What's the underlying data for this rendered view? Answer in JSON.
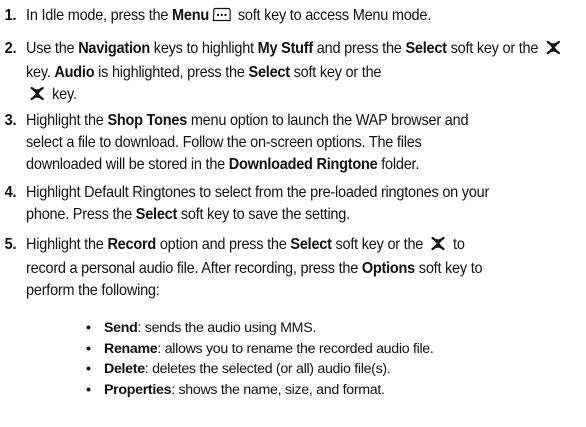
{
  "steps": [
    {
      "num": "1.",
      "parts": [
        {
          "t": "In Idle mode, press the "
        },
        {
          "b": "Menu"
        },
        {
          "icon": "menu-softkey-icon"
        },
        {
          "t": " soft key to access Menu mode."
        }
      ]
    },
    {
      "num": "2.",
      "parts": [
        {
          "t": "Use the "
        },
        {
          "b": "Navigation"
        },
        {
          "t": " keys to highlight "
        },
        {
          "b": "My Stuff"
        },
        {
          "t": " and press the "
        },
        {
          "b": "Select"
        },
        {
          "t": " soft key or the "
        },
        {
          "icon": "select-key-icon"
        },
        {
          "t": " key. "
        },
        {
          "b": "Audio"
        },
        {
          "t": " is highlighted, press the "
        },
        {
          "b": "Select"
        },
        {
          "t": " soft key or the "
        },
        {
          "br": true
        },
        {
          "icon": "select-key-icon"
        },
        {
          "t": " key."
        }
      ]
    },
    {
      "num": "3.",
      "parts": [
        {
          "t": "Highlight the "
        },
        {
          "b": "Shop Tones"
        },
        {
          "t": " menu option to launch the WAP browser and"
        },
        {
          "br": true
        },
        {
          "t": "select a file to download. Follow the on-screen options. The files"
        },
        {
          "br": true
        },
        {
          "t": "downloaded will be stored in the "
        },
        {
          "b": "Downloaded Ringtone"
        },
        {
          "t": " folder."
        }
      ]
    },
    {
      "num": "4.",
      "parts": [
        {
          "t": "Highlight Default Ringtones to select from the pre-loaded ringtones on your"
        },
        {
          "br": true
        },
        {
          "t": "phone. Press the "
        },
        {
          "b": "Select"
        },
        {
          "t": " soft key to save the setting."
        }
      ]
    },
    {
      "num": "5.",
      "parts": [
        {
          "t": "Highlight the "
        },
        {
          "b": "Record"
        },
        {
          "t": " option and press the "
        },
        {
          "b": "Select"
        },
        {
          "t": " soft key or the "
        },
        {
          "icon": "select-key-icon"
        },
        {
          "t": " to"
        },
        {
          "br": true
        },
        {
          "t": "record a personal audio file.  After recording, press the "
        },
        {
          "b": "Options"
        },
        {
          "t": " soft key to"
        },
        {
          "br": true
        },
        {
          "t": "perform the following:"
        }
      ]
    }
  ],
  "options": [
    {
      "bullet": "•",
      "term": "Send",
      "desc": ": sends the audio using MMS."
    },
    {
      "bullet": "•",
      "term": "Rename",
      "desc": ": allows you to rename the recorded audio file."
    },
    {
      "bullet": "•",
      "term": "Delete",
      "desc": ": deletes the selected (or all) audio file(s)."
    },
    {
      "bullet": "•",
      "term": "Properties",
      "desc": ": shows the name, size, and format."
    }
  ]
}
